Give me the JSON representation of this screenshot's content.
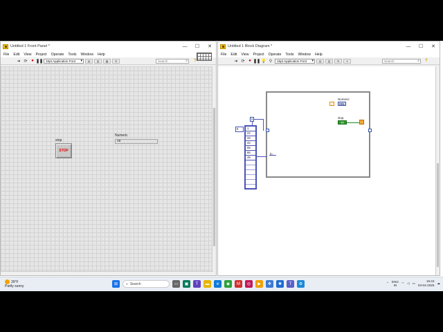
{
  "front_panel": {
    "title": "Untitled 1 Front Panel *",
    "menu": [
      "File",
      "Edit",
      "View",
      "Project",
      "Operate",
      "Tools",
      "Window",
      "Help"
    ],
    "font_selector": "15pt Application Font",
    "search_placeholder": "Search",
    "stop_control": {
      "label": "stop",
      "button_text": "STOP"
    },
    "numeric_indicator": {
      "label": "Numeric",
      "value": "49"
    }
  },
  "block_diagram": {
    "title": "Untitled 1 Block Diagram *",
    "menu": [
      "File",
      "Edit",
      "View",
      "Project",
      "Operate",
      "Tools",
      "Window",
      "Help"
    ],
    "font_selector": "15pt Application Font",
    "search_placeholder": "Search",
    "numeric_terminal": {
      "label": "Numeric",
      "tag": "DBL"
    },
    "stop_terminal": {
      "label": "stop",
      "tag": "TF"
    },
    "index_constant": "0",
    "array_index": "0",
    "array_values": [
      "1",
      "22",
      "33",
      "44",
      "55",
      "66",
      "49"
    ],
    "wire_colors": {
      "numeric": "#4a52b8",
      "boolean": "#1c8a1c",
      "stop": "#e08a00"
    }
  },
  "window_controls": [
    "—",
    "☐",
    "✕"
  ],
  "taskbar": {
    "weather_temp": "39°F",
    "weather_desc": "Partly sunny",
    "search_label": "Search",
    "language_top": "ENG",
    "language_bottom": "IN",
    "time": "15:43",
    "date": "03-04-2025"
  }
}
